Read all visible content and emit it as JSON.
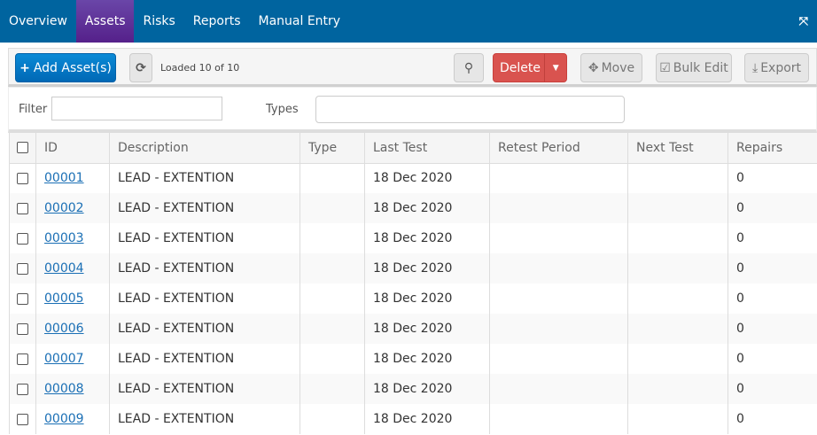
{
  "nav": {
    "tabs": [
      "Overview",
      "Assets",
      "Risks",
      "Reports",
      "Manual Entry"
    ],
    "active": "Assets"
  },
  "toolbar": {
    "add": "Add Asset(s)",
    "loaded": "Loaded 10 of 10",
    "delete": "Delete",
    "move": "Move",
    "bulk_edit": "Bulk Edit",
    "export": "Export"
  },
  "filters": {
    "filter_label": "Filter",
    "filter_value": "",
    "types_label": "Types",
    "types_value": ""
  },
  "table": {
    "columns": [
      "ID",
      "Description",
      "Type",
      "Last Test",
      "Retest Period",
      "Next Test",
      "Repairs"
    ],
    "rows": [
      {
        "id": "00001",
        "description": "LEAD - EXTENTION",
        "type": "",
        "last_test": "18 Dec 2020",
        "retest": "",
        "next_test": "",
        "repairs": "0"
      },
      {
        "id": "00002",
        "description": "LEAD - EXTENTION",
        "type": "",
        "last_test": "18 Dec 2020",
        "retest": "",
        "next_test": "",
        "repairs": "0"
      },
      {
        "id": "00003",
        "description": "LEAD - EXTENTION",
        "type": "",
        "last_test": "18 Dec 2020",
        "retest": "",
        "next_test": "",
        "repairs": "0"
      },
      {
        "id": "00004",
        "description": "LEAD - EXTENTION",
        "type": "",
        "last_test": "18 Dec 2020",
        "retest": "",
        "next_test": "",
        "repairs": "0"
      },
      {
        "id": "00005",
        "description": "LEAD - EXTENTION",
        "type": "",
        "last_test": "18 Dec 2020",
        "retest": "",
        "next_test": "",
        "repairs": "0"
      },
      {
        "id": "00006",
        "description": "LEAD - EXTENTION",
        "type": "",
        "last_test": "18 Dec 2020",
        "retest": "",
        "next_test": "",
        "repairs": "0"
      },
      {
        "id": "00007",
        "description": "LEAD - EXTENTION",
        "type": "",
        "last_test": "18 Dec 2020",
        "retest": "",
        "next_test": "",
        "repairs": "0"
      },
      {
        "id": "00008",
        "description": "LEAD - EXTENTION",
        "type": "",
        "last_test": "18 Dec 2020",
        "retest": "",
        "next_test": "",
        "repairs": "0"
      },
      {
        "id": "00009",
        "description": "LEAD - EXTENTION",
        "type": "",
        "last_test": "18 Dec 2020",
        "retest": "",
        "next_test": "",
        "repairs": "0"
      }
    ]
  }
}
